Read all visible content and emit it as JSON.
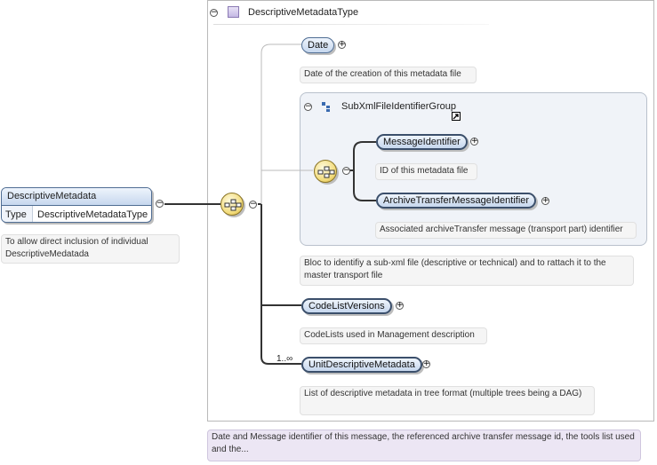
{
  "root": {
    "name": "DescriptiveMetadata",
    "type_key": "Type",
    "type_value": "DescriptiveMetadataType",
    "doc": "To allow direct inclusion of individual DescriptiveMedatada"
  },
  "complex_type": {
    "name": "DescriptiveMetadataType",
    "doc": "Date and Message identifier of this message, the referenced archive transfer message id, the tools list used and the..."
  },
  "elements": {
    "date": {
      "name": "Date",
      "doc": "Date of the creation of this metadata file"
    },
    "group": {
      "name": "SubXmlFileIdentifierGroup",
      "doc": "Bloc to identifiy a sub-xml file (descriptive or technical) and to rattach it to the master transport file",
      "message_identifier": {
        "name": "MessageIdentifier",
        "doc": "ID of this metadata file"
      },
      "archive_transfer": {
        "name": "ArchiveTransferMessageIdentifier",
        "doc": "Associated archiveTransfer message (transport part) identifier"
      }
    },
    "code_list_versions": {
      "name": "CodeListVersions",
      "doc": "CodeLists used in Management description"
    },
    "unit_descriptive": {
      "name": "UnitDescriptiveMetadata",
      "occurrence": "1..∞",
      "doc": "List of descriptive metadata in tree format (multiple trees being a DAG)"
    }
  },
  "colors": {
    "element_fill": "#c6d7ee",
    "element_border": "#4f6d93",
    "sequence_fill": "#f2db7a"
  }
}
